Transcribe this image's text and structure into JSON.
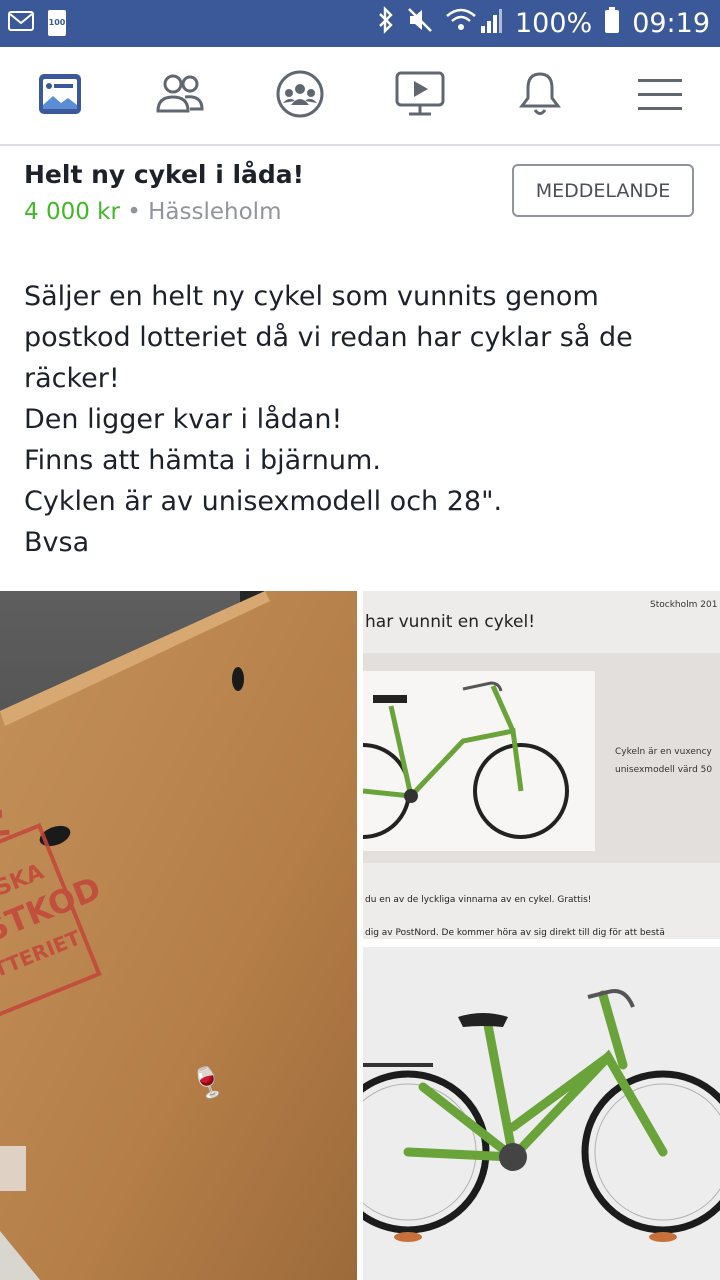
{
  "status_bar": {
    "battery": "100%",
    "time": "09:19",
    "small_badge": "100"
  },
  "nav": {
    "items": [
      {
        "name": "news-feed"
      },
      {
        "name": "friends"
      },
      {
        "name": "groups"
      },
      {
        "name": "watch"
      },
      {
        "name": "notifications"
      },
      {
        "name": "menu"
      }
    ]
  },
  "listing": {
    "title": "Helt ny cykel i låda!",
    "price": "4 000 kr",
    "separator": "•",
    "location": "Hässleholm",
    "message_button": "MEDDELANDE",
    "description_lines": [
      "Säljer en helt ny cykel som vunnits genom",
      "postkod lotteriet då vi redan har cyklar så de",
      "räcker!",
      "Den ligger kvar i lådan!",
      "Finns att hämta i bjärnum.",
      "Cyklen är av unisexmodell och 28\".",
      "Bvsa"
    ]
  },
  "photos": {
    "box_text": [
      "SVENSKA",
      "POSTKOD",
      "LOTTERIET"
    ],
    "letter_header_fragment": "Stockholm 201",
    "letter_title_fragment": "har vunnit en cykel!",
    "letter_side_text": [
      "Cykeln är en vuxency",
      "unisexmodell värd 50"
    ],
    "letter_line1": "du en av de lyckliga vinnarna av en cykel. Grattis!",
    "letter_line2": "dig av PostNord. De kommer höra av sig direkt till dig för att bestä"
  },
  "colors": {
    "facebook_blue": "#3b5998",
    "price_green": "#42b72a",
    "bike_green": "#6aa33a"
  }
}
